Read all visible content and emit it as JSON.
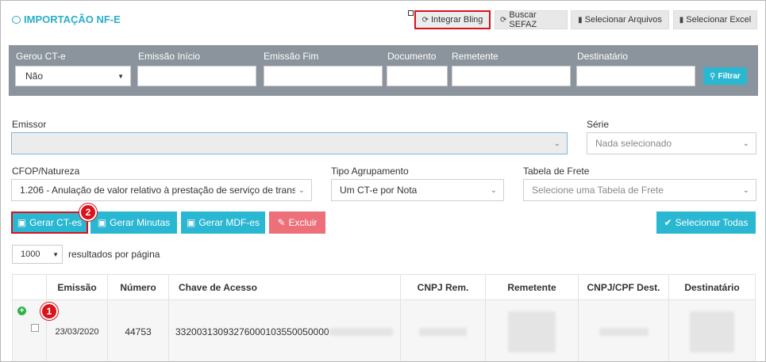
{
  "header": {
    "title": "IMPORTAÇÃO NF-E",
    "buttons": {
      "integrar": "Integrar Bling",
      "buscar": "Buscar SEFAZ",
      "arquivos": "Selecionar Arquivos",
      "excel": "Selecionar Excel"
    }
  },
  "filters": {
    "gerou_cte": {
      "label": "Gerou CT-e",
      "value": "Não"
    },
    "emissao_inicio": {
      "label": "Emissão Início",
      "value": ""
    },
    "emissao_fim": {
      "label": "Emissão Fim",
      "value": ""
    },
    "documento": {
      "label": "Documento",
      "value": ""
    },
    "remetente": {
      "label": "Remetente",
      "value": ""
    },
    "destinatario": {
      "label": "Destinatário",
      "value": ""
    },
    "filtrar": "Filtrar"
  },
  "form": {
    "emissor": {
      "label": "Emissor",
      "value": ""
    },
    "serie": {
      "label": "Série",
      "placeholder": "Nada selecionado"
    },
    "cfop": {
      "label": "CFOP/Natureza",
      "value": "1.206 - Anulação de valor relativo à prestação de serviço de transp"
    },
    "agrupamento": {
      "label": "Tipo Agrupamento",
      "value": "Um CT-e por Nota"
    },
    "tabela": {
      "label": "Tabela de Frete",
      "placeholder": "Selecione uma Tabela de Frete"
    }
  },
  "actions": {
    "gerar_ctes": "Gerar CT-es",
    "gerar_minutas": "Gerar Minutas",
    "gerar_mdfes": "Gerar MDF-es",
    "excluir": "Excluir",
    "selecionar_todas": "Selecionar Todas"
  },
  "badges": {
    "one": "1",
    "two": "2"
  },
  "pager": {
    "size": "1000",
    "text": "resultados por página"
  },
  "table": {
    "columns": [
      "Emissão",
      "Número",
      "Chave de Acesso",
      "CNPJ Rem.",
      "Remetente",
      "CNPJ/CPF Dest.",
      "Destinatário"
    ],
    "rows": [
      {
        "emissao": "23/03/2020",
        "numero": "44753",
        "chave": "33200313093276000103550050000"
      }
    ]
  },
  "colors": {
    "accent": "#2ab7d1",
    "danger": "#ec6f7a",
    "highlight": "#d9121b",
    "filterbar": "#8b949d"
  }
}
